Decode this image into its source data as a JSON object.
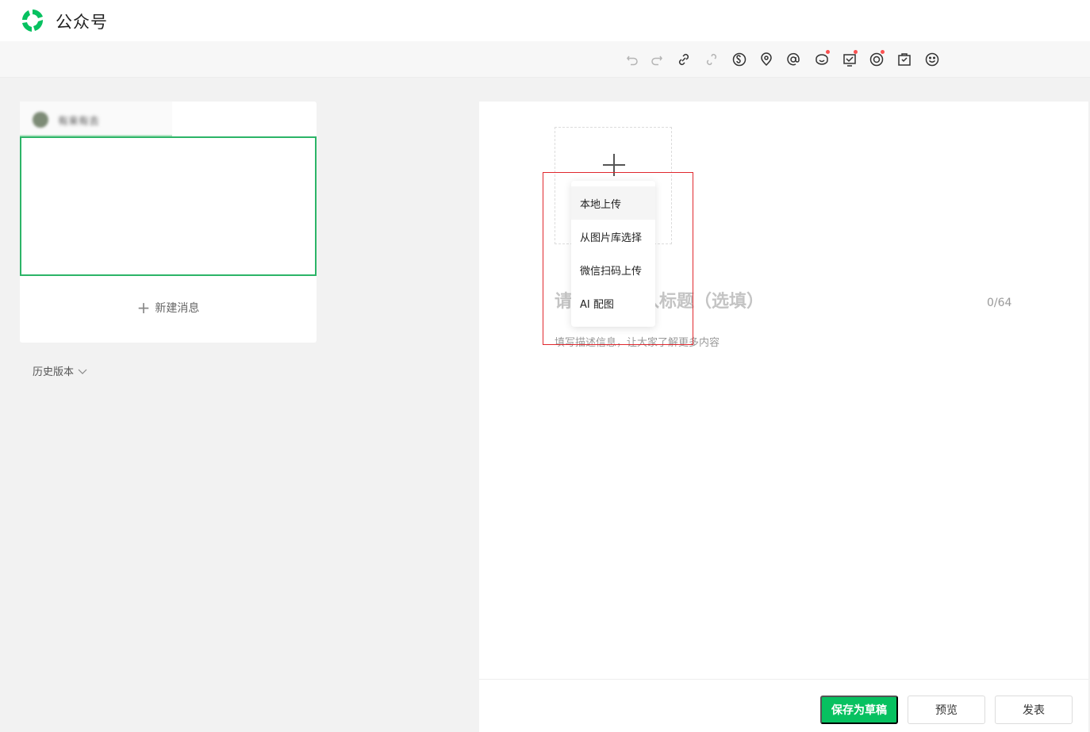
{
  "header": {
    "app_title": "公众号"
  },
  "toolbar": {
    "icons": [
      "undo-icon",
      "redo-icon",
      "link-icon",
      "unlink-icon",
      "mini-program-icon",
      "location-icon",
      "mention-icon",
      "video-channel-icon",
      "poll-icon",
      "live-icon",
      "product-icon",
      "emoji-icon"
    ]
  },
  "sidebar": {
    "account_name": "有来有去",
    "new_message": "新建消息",
    "history": "历史版本"
  },
  "editor": {
    "title_placeholder": "请在这里输入标题（选填）",
    "title_count": "0/64",
    "desc_placeholder": "填写描述信息，让大家了解更多内容"
  },
  "cover_menu": {
    "items": [
      "本地上传",
      "从图片库选择",
      "微信扫码上传",
      "AI 配图"
    ]
  },
  "footer": {
    "save_draft": "保存为草稿",
    "preview": "预览",
    "publish": "发表"
  },
  "colors": {
    "brand_green": "#07c160",
    "selected_border": "#2cb467",
    "highlight_red": "#e0282e",
    "notify_dot": "#fa5151"
  }
}
